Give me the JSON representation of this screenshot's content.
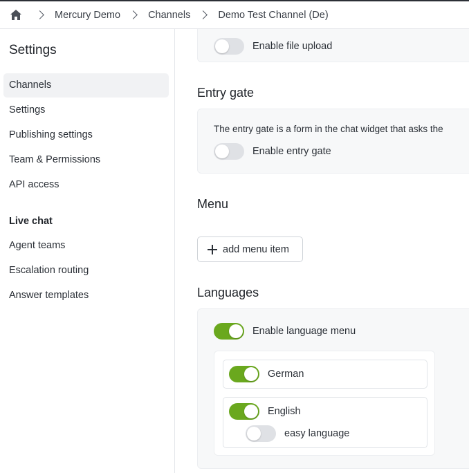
{
  "breadcrumb": {
    "home_icon": "home-icon",
    "items": [
      "Mercury Demo",
      "Channels",
      "Demo Test Channel (De)"
    ]
  },
  "sidebar": {
    "title": "Settings",
    "items": [
      "Channels",
      "Settings",
      "Publishing settings",
      "Team & Permissions",
      "API access"
    ],
    "live_chat_heading": "Live chat",
    "live_chat_items": [
      "Agent teams",
      "Escalation routing",
      "Answer templates"
    ]
  },
  "main": {
    "file_upload": {
      "label": "Enable file upload",
      "enabled": false
    },
    "entry_gate": {
      "title": "Entry gate",
      "description": "The entry gate is a form in the chat widget that asks the",
      "toggle_label": "Enable entry gate",
      "enabled": false
    },
    "menu": {
      "title": "Menu",
      "add_button_label": "add menu item"
    },
    "languages": {
      "title": "Languages",
      "toggle_label": "Enable language menu",
      "enabled": true,
      "items": [
        {
          "label": "German",
          "enabled": true
        },
        {
          "label": "English",
          "enabled": true,
          "sub_label": "easy language",
          "sub_enabled": false
        }
      ]
    }
  },
  "colors": {
    "toggle_on": "#6aa81e",
    "toggle_off": "#dfe1e5",
    "active_nav_bg": "#f1f2f4",
    "card_bg": "#f7f8f9"
  }
}
